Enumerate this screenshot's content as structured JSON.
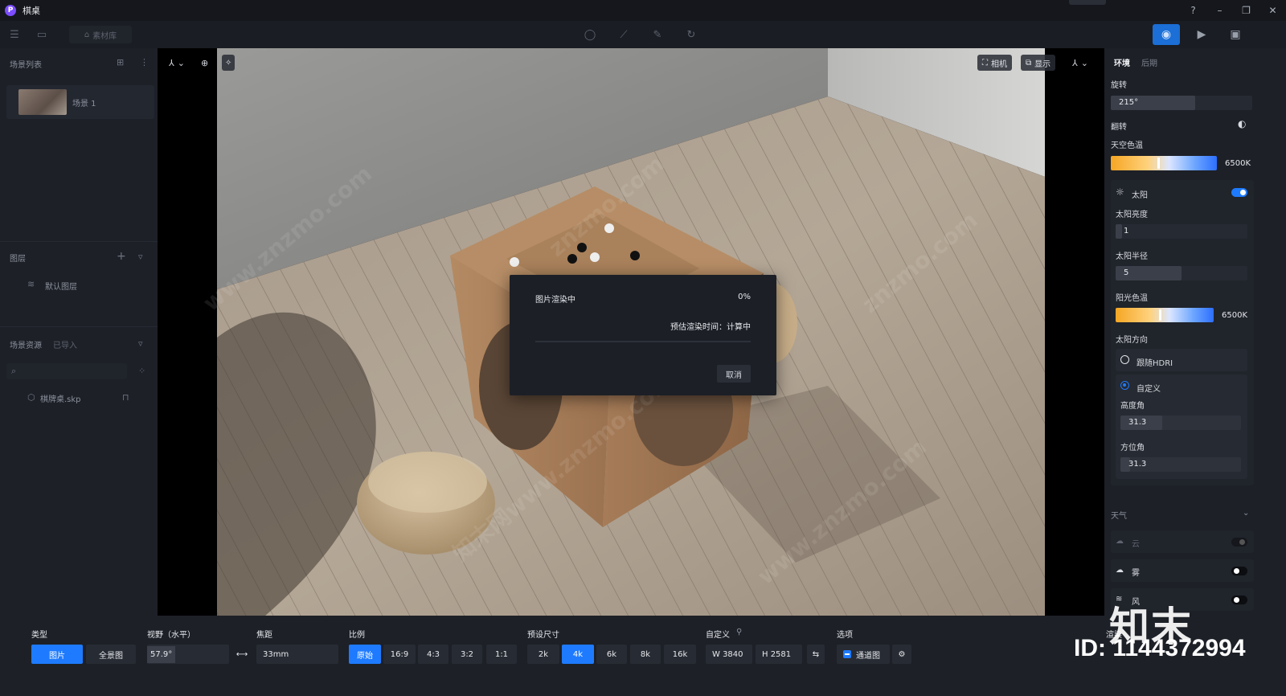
{
  "app": {
    "title": "棋桌",
    "logo_letter": "P"
  },
  "toolbar": {
    "material_label": "素材库"
  },
  "left_panel": {
    "scene_list_title": "场景列表",
    "scene_item": "场景 1",
    "layers_title": "图层",
    "default_layer": "默认图层",
    "assets_title": "场景资源",
    "assets_status": "已导入",
    "asset_file": "棋牌桌.skp"
  },
  "viewport": {
    "camera_label": "相机",
    "display_label": "显示",
    "watermarks": [
      "www.znzmo.com",
      "znzmo.com",
      "知末网www.znzmo.com"
    ]
  },
  "render_dialog": {
    "title": "图片渲染中",
    "percent": "0%",
    "progress": 0,
    "eta": "预估渲染时间：计算中",
    "cancel": "取消"
  },
  "right_panel": {
    "tab_env": "环境",
    "tab_post": "后期",
    "rotation_label": "旋转",
    "rotation_value": "215°",
    "flip_label": "翻转",
    "sky_temp_label": "天空色温",
    "sky_temp_value": "6500K",
    "sun_label": "太阳",
    "sun_brightness_label": "太阳亮度",
    "sun_brightness_value": "1",
    "sun_radius_label": "太阳半径",
    "sun_radius_value": "5",
    "sunlight_temp_label": "阳光色温",
    "sunlight_temp_value": "6500K",
    "sun_direction_label": "太阳方向",
    "follow_hdri": "跟随HDRI",
    "custom": "自定义",
    "altitude_label": "高度角",
    "altitude_value": "31.3",
    "azimuth_label": "方位角",
    "azimuth_value": "31.3",
    "weather_label": "天气",
    "cloud_label": "云",
    "fog_label": "雾",
    "wind_label": "风"
  },
  "bottom_panel": {
    "type_label": "类型",
    "type_image": "图片",
    "type_panorama": "全景图",
    "fov_label": "视野（水平）",
    "fov_value": "57.9°",
    "focal_label": "焦距",
    "focal_value": "33mm",
    "ratio_label": "比例",
    "ratios": [
      "原始",
      "16:9",
      "4:3",
      "3:2",
      "1:1"
    ],
    "preset_label": "预设尺寸",
    "presets": [
      "2k",
      "4k",
      "6k",
      "8k",
      "16k"
    ],
    "custom_label": "自定义",
    "width_value": "W  3840",
    "height_value": "H  2581",
    "options_label": "选项",
    "channel_label": "通道图",
    "render_label": "渲染"
  },
  "brand": {
    "mark": "知末",
    "id": "ID: 1144372994"
  },
  "colors": {
    "accent": "#1e7bff",
    "panel": "#1d2027",
    "background": "#1a1d24"
  }
}
